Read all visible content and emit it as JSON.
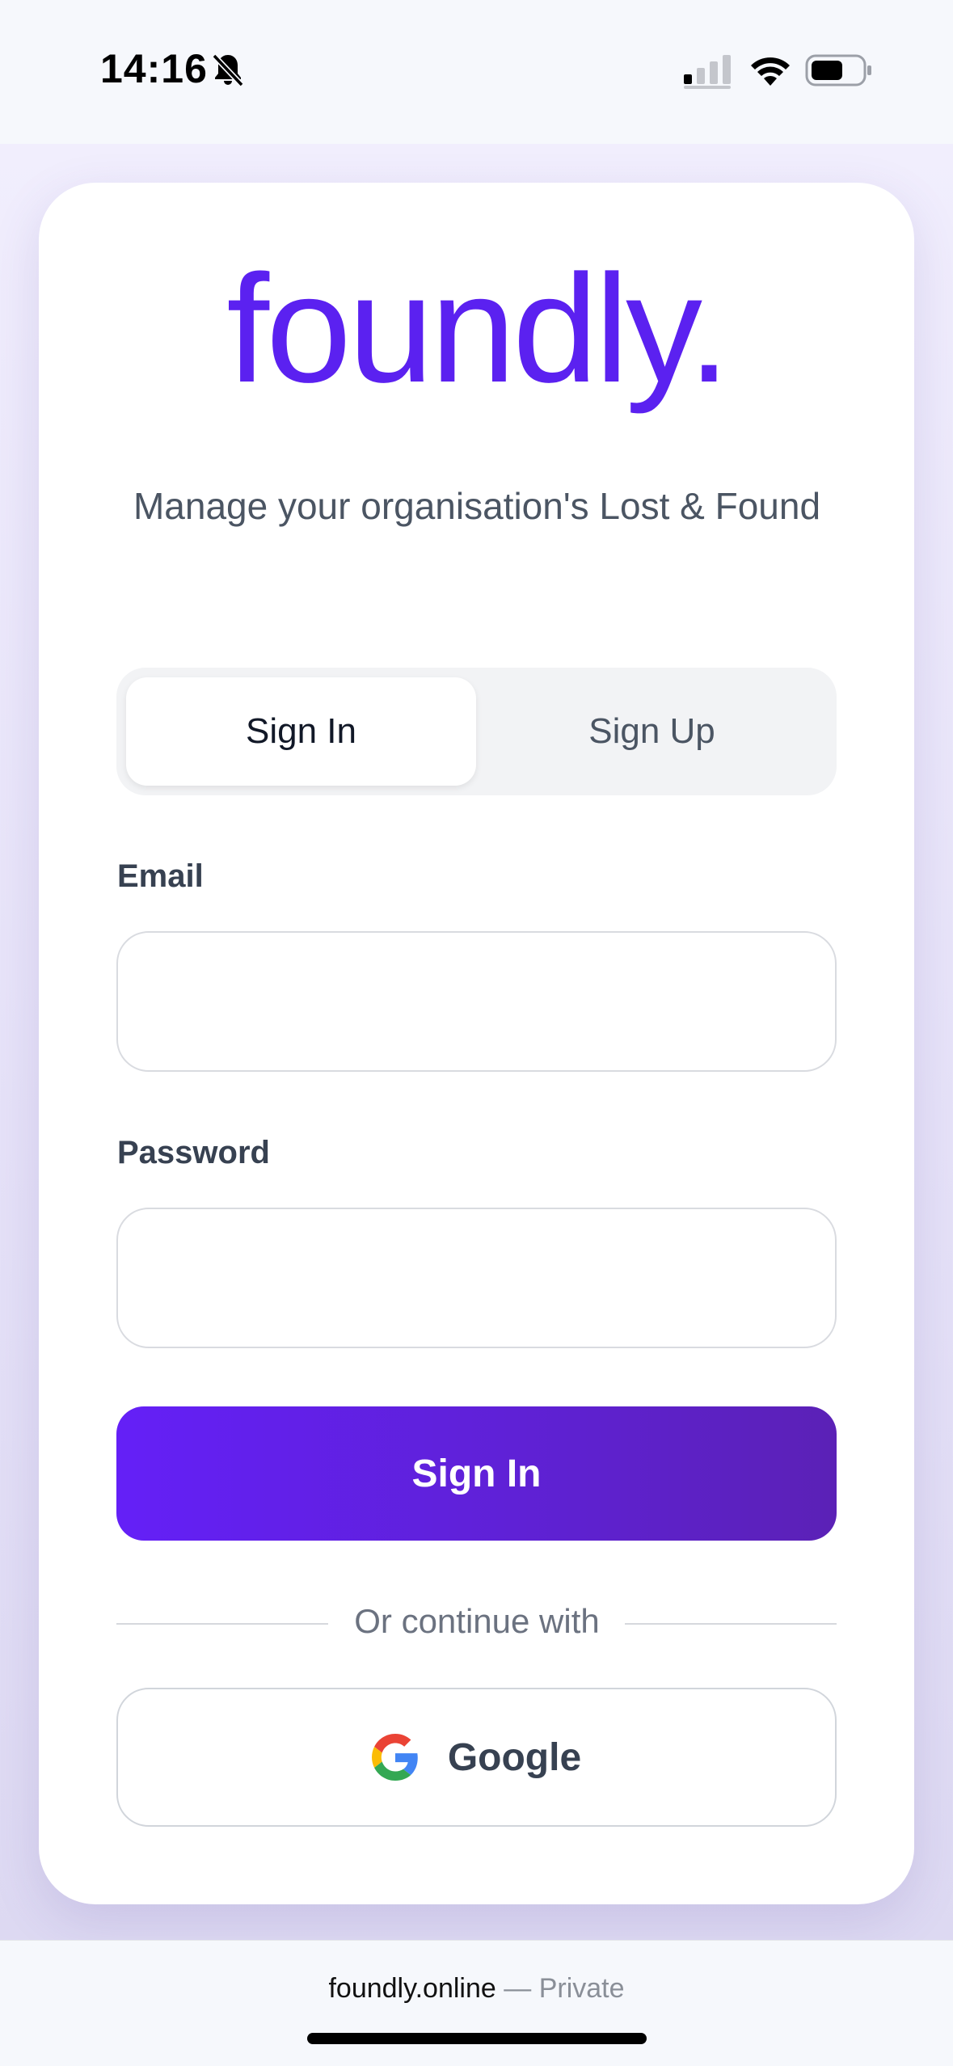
{
  "status_bar": {
    "time": "14:16",
    "icons": [
      "bell-slash-icon",
      "signal-icon",
      "wifi-icon",
      "battery-icon"
    ]
  },
  "brand": {
    "logo_text": "foundly.",
    "color": "#5b21f0"
  },
  "tagline": "Manage your organisation's Lost & Found",
  "tabs": [
    {
      "label": "Sign In",
      "active": true
    },
    {
      "label": "Sign Up",
      "active": false
    }
  ],
  "form": {
    "email_label": "Email",
    "email_value": "",
    "password_label": "Password",
    "password_value": "",
    "submit_label": "Sign In"
  },
  "divider_text": "Or continue with",
  "social": {
    "google_label": "Google",
    "icon": "google-icon"
  },
  "browser": {
    "domain": "foundly.online",
    "separator": "—",
    "mode": "Private"
  }
}
